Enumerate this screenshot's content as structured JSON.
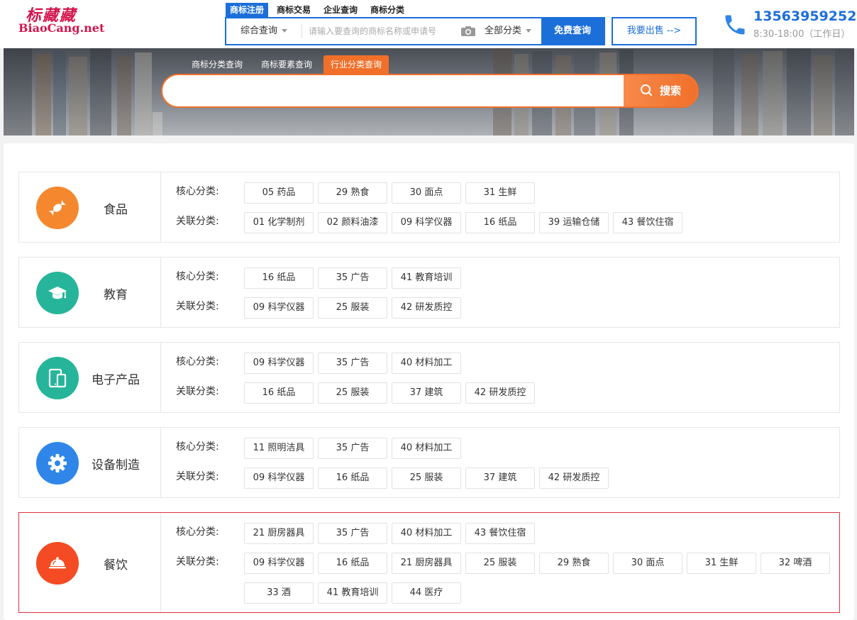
{
  "logo": {
    "cn": "标藏藏",
    "en": "BiaoCang.net"
  },
  "top_tabs": [
    {
      "label": "商标注册",
      "active": true
    },
    {
      "label": "商标交易",
      "active": false
    },
    {
      "label": "企业查询",
      "active": false
    },
    {
      "label": "商标分类",
      "active": false
    }
  ],
  "search": {
    "type_label": "综合查询",
    "placeholder": "请输入要查询的商标名称或申请号",
    "category_label": "全部分类",
    "button_label": "免费查询"
  },
  "sell_button": "我要出售 -->",
  "contact": {
    "phone": "13563959252",
    "hours": "8:30-18:00（工作日）"
  },
  "banner": {
    "tabs": [
      {
        "label": "商标分类查询",
        "active": false
      },
      {
        "label": "商标要素查询",
        "active": false
      },
      {
        "label": "行业分类查询",
        "active": true
      }
    ],
    "search_button": "搜索",
    "search_value": ""
  },
  "labels": {
    "core": "核心分类:",
    "related": "关联分类:"
  },
  "industries": [
    {
      "name": "食品",
      "icon": "candy-icon",
      "color": "#f5882e",
      "core": [
        "05 药品",
        "29 熟食",
        "30 面点",
        "31 生鲜"
      ],
      "related": [
        "01 化学制剂",
        "02 颜料油漆",
        "09 科学仪器",
        "16 纸品",
        "39 运输仓储",
        "43 餐饮住宿"
      ]
    },
    {
      "name": "教育",
      "icon": "graduation-cap-icon",
      "color": "#26b59a",
      "core": [
        "16 纸品",
        "35 广告",
        "41 教育培训"
      ],
      "related": [
        "09 科学仪器",
        "25 服装",
        "42 研发质控"
      ]
    },
    {
      "name": "电子产品",
      "icon": "devices-icon",
      "color": "#26b59a",
      "core": [
        "09 科学仪器",
        "35 广告",
        "40 材料加工"
      ],
      "related": [
        "16 纸品",
        "25 服装",
        "37 建筑",
        "42 研发质控"
      ]
    },
    {
      "name": "设备制造",
      "icon": "gear-icon",
      "color": "#2f86e8",
      "core": [
        "11 照明洁具",
        "35 广告",
        "40 材料加工"
      ],
      "related": [
        "09 科学仪器",
        "16 纸品",
        "25 服装",
        "37 建筑",
        "42 研发质控"
      ]
    },
    {
      "name": "餐饮",
      "icon": "food-cloche-icon",
      "color": "#f44b24",
      "core": [
        "21 厨房器具",
        "35 广告",
        "40 材料加工",
        "43 餐饮住宿"
      ],
      "related": [
        "09 科学仪器",
        "16 纸品",
        "21 厨房器具",
        "25 服装",
        "29 熟食",
        "30 面点",
        "31 生鲜",
        "32 啤酒",
        "33 酒",
        "41 教育培训",
        "44 医疗"
      ]
    }
  ]
}
